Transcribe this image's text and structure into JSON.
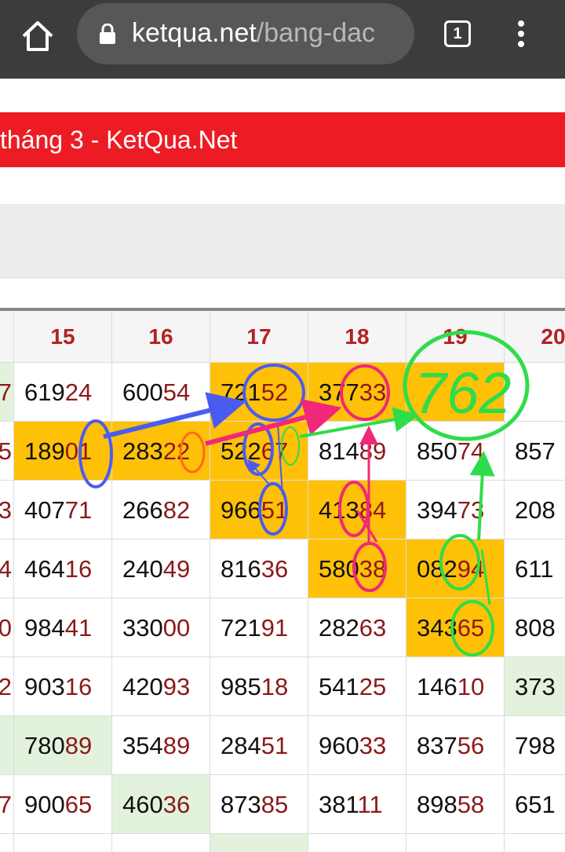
{
  "browser": {
    "url_host": "ketqua.net",
    "url_path": "/bang-dac",
    "tab_count": "1"
  },
  "banner": {
    "title": "tháng 3 - KetQua.Net"
  },
  "table": {
    "edge_values": [
      "7",
      "5",
      "3",
      "4",
      "0",
      "2",
      "",
      "7",
      ""
    ],
    "columns": [
      {
        "header": "15",
        "cells": [
          {
            "p": "619",
            "s": "24",
            "h": "none"
          },
          {
            "p": "189",
            "s": "01",
            "h": "yellow"
          },
          {
            "p": "407",
            "s": "71",
            "h": "none"
          },
          {
            "p": "464",
            "s": "16",
            "h": "none"
          },
          {
            "p": "984",
            "s": "41",
            "h": "none"
          },
          {
            "p": "903",
            "s": "16",
            "h": "none"
          },
          {
            "p": "780",
            "s": "89",
            "h": "green"
          },
          {
            "p": "900",
            "s": "65",
            "h": "none"
          },
          {
            "p": "",
            "s": "",
            "h": "none"
          }
        ]
      },
      {
        "header": "16",
        "cells": [
          {
            "p": "600",
            "s": "54",
            "h": "none"
          },
          {
            "p": "283",
            "s": "22",
            "h": "yellow"
          },
          {
            "p": "266",
            "s": "82",
            "h": "none"
          },
          {
            "p": "240",
            "s": "49",
            "h": "none"
          },
          {
            "p": "330",
            "s": "00",
            "h": "none"
          },
          {
            "p": "420",
            "s": "93",
            "h": "none"
          },
          {
            "p": "354",
            "s": "89",
            "h": "none"
          },
          {
            "p": "460",
            "s": "36",
            "h": "green"
          },
          {
            "p": "",
            "s": "",
            "h": "none"
          }
        ]
      },
      {
        "header": "17",
        "cells": [
          {
            "p": "721",
            "s": "52",
            "h": "yellow"
          },
          {
            "p": "522",
            "s": "67",
            "h": "yellow"
          },
          {
            "p": "966",
            "s": "51",
            "h": "yellow"
          },
          {
            "p": "816",
            "s": "36",
            "h": "none"
          },
          {
            "p": "721",
            "s": "91",
            "h": "none"
          },
          {
            "p": "985",
            "s": "18",
            "h": "none"
          },
          {
            "p": "284",
            "s": "51",
            "h": "none"
          },
          {
            "p": "873",
            "s": "85",
            "h": "none"
          },
          {
            "p": "",
            "s": "",
            "h": "green"
          }
        ]
      },
      {
        "header": "18",
        "cells": [
          {
            "p": "377",
            "s": "33",
            "h": "yellow"
          },
          {
            "p": "814",
            "s": "89",
            "h": "none"
          },
          {
            "p": "413",
            "s": "84",
            "h": "yellow"
          },
          {
            "p": "580",
            "s": "38",
            "h": "yellow"
          },
          {
            "p": "282",
            "s": "63",
            "h": "none"
          },
          {
            "p": "541",
            "s": "25",
            "h": "none"
          },
          {
            "p": "960",
            "s": "33",
            "h": "none"
          },
          {
            "p": "381",
            "s": "11",
            "h": "none"
          },
          {
            "p": "",
            "s": "",
            "h": "none"
          }
        ]
      },
      {
        "header": "19",
        "cells": [
          {
            "p": "",
            "s": "",
            "h": "yellow"
          },
          {
            "p": "850",
            "s": "74",
            "h": "none"
          },
          {
            "p": "394",
            "s": "73",
            "h": "none"
          },
          {
            "p": "082",
            "s": "94",
            "h": "yellow"
          },
          {
            "p": "343",
            "s": "65",
            "h": "yellow"
          },
          {
            "p": "146",
            "s": "10",
            "h": "none"
          },
          {
            "p": "837",
            "s": "56",
            "h": "none"
          },
          {
            "p": "898",
            "s": "58",
            "h": "none"
          },
          {
            "p": "",
            "s": "",
            "h": "none"
          }
        ]
      },
      {
        "header": "20",
        "cells": [
          {
            "p": "",
            "s": "",
            "h": "none"
          },
          {
            "p": "857",
            "s": "",
            "h": "none"
          },
          {
            "p": "208",
            "s": "",
            "h": "none"
          },
          {
            "p": "611",
            "s": "",
            "h": "none"
          },
          {
            "p": "808",
            "s": "",
            "h": "none"
          },
          {
            "p": "373",
            "s": "",
            "h": "green"
          },
          {
            "p": "798",
            "s": "",
            "h": "none"
          },
          {
            "p": "651",
            "s": "",
            "h": "none"
          },
          {
            "p": "",
            "s": "",
            "h": "none"
          }
        ]
      }
    ]
  },
  "annotation": {
    "handwritten_note": "762"
  },
  "colors": {
    "highlight": "#ffc107",
    "soft_green": "#e3f2dc",
    "banner_red": "#ed1c24",
    "marker_blue": "#4a5cf0",
    "marker_pink": "#f0287a",
    "marker_green": "#2fdc4a"
  }
}
